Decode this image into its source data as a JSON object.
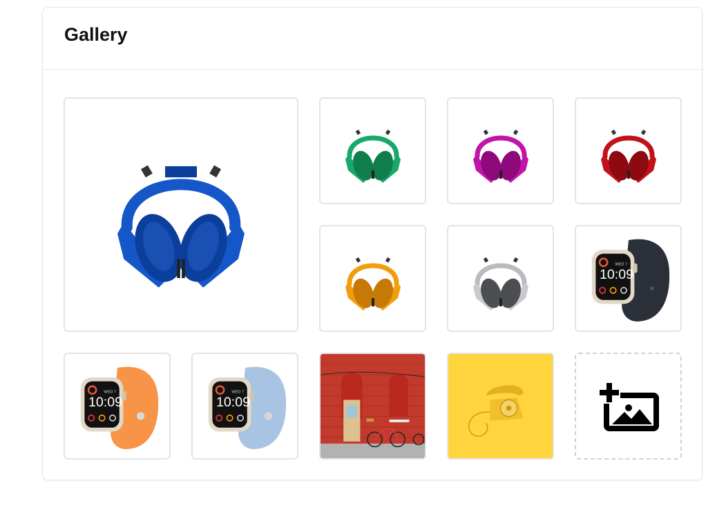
{
  "card": {
    "title": "Gallery"
  },
  "colors": {
    "blue": "#1556c8",
    "blue_dark": "#0c3e9c",
    "green": "#17a86a",
    "green_dark": "#0d7e4c",
    "magenta": "#c114a9",
    "magenta_dark": "#8e0a7b",
    "red": "#c1111a",
    "red_dark": "#8d0a10",
    "orange": "#f19e0c",
    "orange_dark": "#c77905",
    "silver": "#b9bbbe",
    "silver_dark": "#4c4e52",
    "watch_black_band": "#2b2f38",
    "watch_orange_band": "#f79448",
    "watch_blue_band": "#a9c4e2",
    "wall_red": "#c23a2c",
    "phone_bg": "#ffd43d",
    "phone_body": "#f0c02c"
  },
  "gallery": {
    "items": [
      {
        "name": "blue-headphones-image",
        "icon": "headphones",
        "color": "blue"
      },
      {
        "name": "green-headphones-image",
        "icon": "headphones",
        "color": "green"
      },
      {
        "name": "magenta-headphones-image",
        "icon": "headphones",
        "color": "magenta"
      },
      {
        "name": "red-headphones-image",
        "icon": "headphones",
        "color": "red"
      },
      {
        "name": "orange-headphones-image",
        "icon": "headphones",
        "color": "orange"
      },
      {
        "name": "silver-headphones-image",
        "icon": "headphones",
        "color": "silver"
      },
      {
        "name": "black-smartwatch-image",
        "icon": "smartwatch",
        "color": "watch_black_band"
      },
      {
        "name": "orange-smartwatch-image",
        "icon": "smartwatch",
        "color": "watch_orange_band"
      },
      {
        "name": "blue-smartwatch-image",
        "icon": "smartwatch",
        "color": "watch_blue_band"
      },
      {
        "name": "red-wall-bicycle-image",
        "icon": "photo-wall-door-bicycle"
      },
      {
        "name": "yellow-telephone-image",
        "icon": "photo-rotary-telephone"
      }
    ],
    "watch_time": "10:09",
    "add_button_icon": "add-photo-icon"
  }
}
